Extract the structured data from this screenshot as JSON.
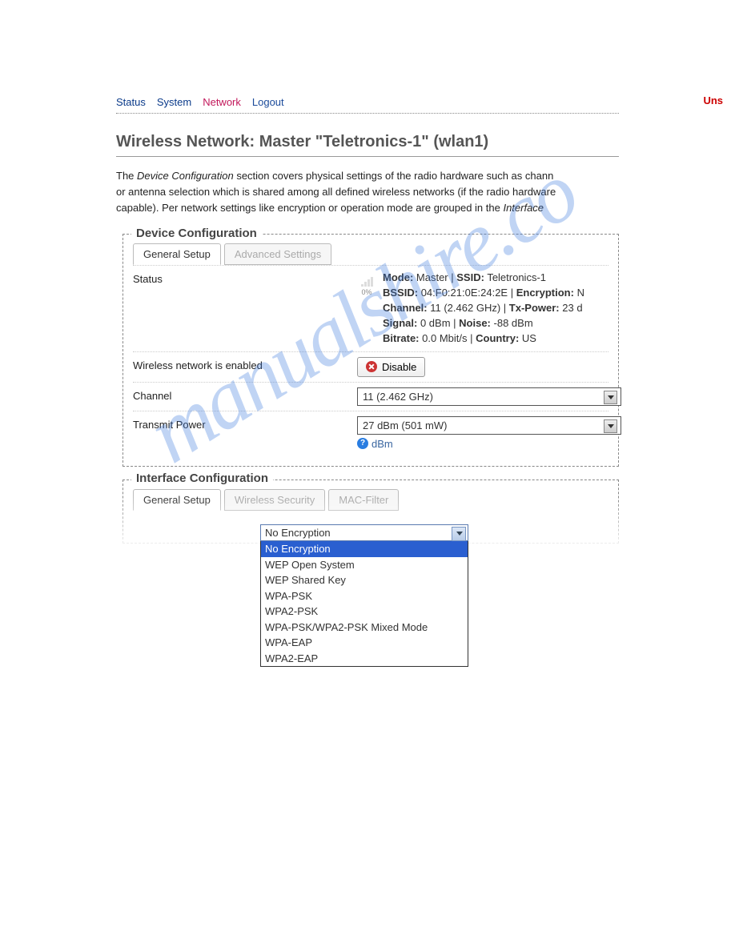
{
  "nav": {
    "status": "Status",
    "system": "System",
    "network": "Network",
    "logout": "Logout",
    "unsaved": "Uns"
  },
  "page_title": "Wireless Network: Master \"Teletronics-1\" (wlan1)",
  "intro_parts": {
    "p1": "The ",
    "em1": "Device Configuration",
    "p2": " section covers physical settings of the radio hardware such as chann",
    "p3": "or antenna selection which is shared among all defined wireless networks (if the radio hardware",
    "p4": "capable). Per network settings like encryption or operation mode are grouped in the ",
    "em2": "Interface "
  },
  "device": {
    "legend": "Device Configuration",
    "tab_general": "General Setup",
    "tab_advanced": "Advanced Settings",
    "status_label": "Status",
    "signal_pct": "0%",
    "status": {
      "mode_k": "Mode:",
      "mode_v": "Master",
      "ssid_k": "SSID:",
      "ssid_v": "Teletronics-1",
      "bssid_k": "BSSID:",
      "bssid_v": "04:F0:21:0E:24:2E",
      "enc_k": "Encryption:",
      "enc_v": "N",
      "chan_k": "Channel:",
      "chan_v": "11 (2.462 GHz)",
      "txp_k": "Tx-Power:",
      "txp_v": "23 d",
      "sig_k": "Signal:",
      "sig_v": "0 dBm",
      "noise_k": "Noise:",
      "noise_v": "-88 dBm",
      "bitrate_k": "Bitrate:",
      "bitrate_v": "0.0 Mbit/s",
      "country_k": "Country:",
      "country_v": "US"
    },
    "enabled_label": "Wireless network is enabled",
    "disable_btn": "Disable",
    "channel_label": "Channel",
    "channel_value": "11 (2.462 GHz)",
    "txpower_label": "Transmit Power",
    "txpower_value": "27 dBm (501 mW)",
    "txpower_hint": "dBm"
  },
  "iface": {
    "legend": "Interface Configuration",
    "tab_general": "General Setup",
    "tab_security": "Wireless Security",
    "tab_mac": "MAC-Filter"
  },
  "encryption_dropdown": {
    "selected": "No Encryption",
    "options": [
      "No Encryption",
      "WEP Open System",
      "WEP Shared Key",
      "WPA-PSK",
      "WPA2-PSK",
      "WPA-PSK/WPA2-PSK Mixed Mode",
      "WPA-EAP",
      "WPA2-EAP"
    ]
  },
  "watermark": "manualshire.co"
}
